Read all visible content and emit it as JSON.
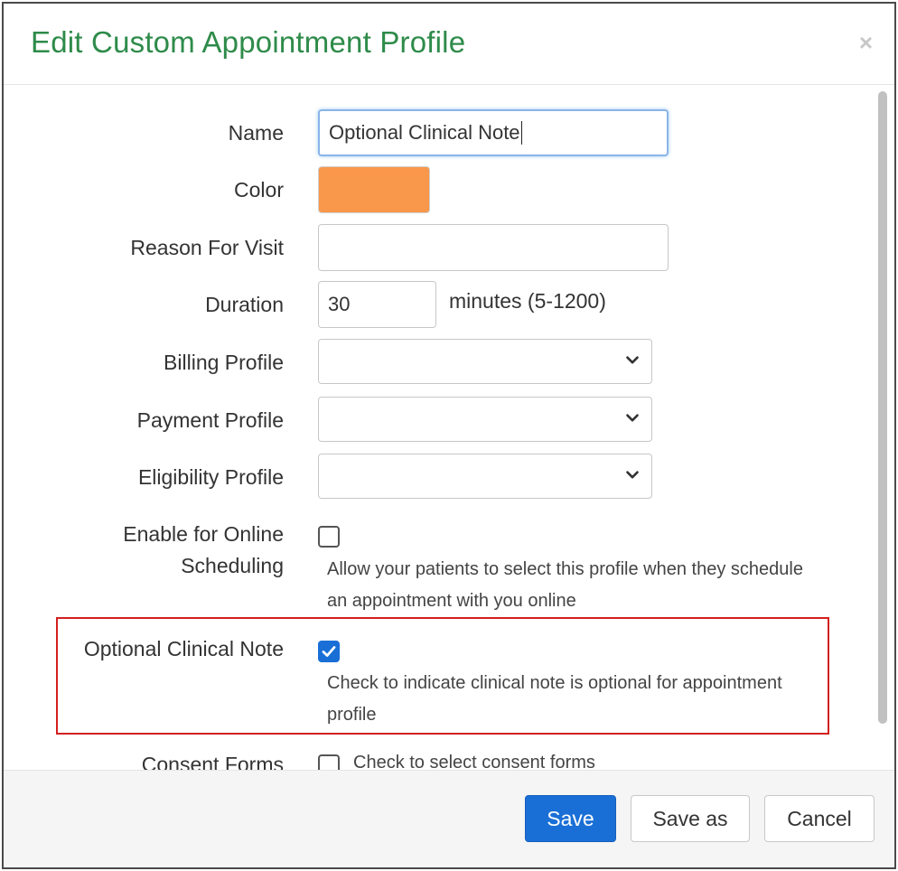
{
  "dialog": {
    "title": "Edit Custom Appointment Profile",
    "close_label": "×"
  },
  "form": {
    "name": {
      "label": "Name",
      "value": "Optional Clinical Note"
    },
    "color": {
      "label": "Color",
      "value": "#f9974a"
    },
    "reason_for_visit": {
      "label": "Reason For Visit",
      "value": ""
    },
    "duration": {
      "label": "Duration",
      "value": "30",
      "unit": "minutes (5-1200)"
    },
    "billing_profile": {
      "label": "Billing Profile",
      "selected": ""
    },
    "payment_profile": {
      "label": "Payment Profile",
      "selected": ""
    },
    "eligibility_profile": {
      "label": "Eligibility Profile",
      "selected": ""
    },
    "online_scheduling": {
      "label_line1": "Enable for Online",
      "label_line2": "Scheduling",
      "checked": false,
      "hint_line1": "Allow your patients to select this profile when they schedule",
      "hint_line2": "an appointment with you online"
    },
    "optional_clinical_note": {
      "label": "Optional Clinical Note",
      "checked": true,
      "hint_line1": "Check to indicate clinical note is optional for appointment",
      "hint_line2": "profile"
    },
    "consent_forms": {
      "label": "Consent Forms",
      "checked": false,
      "hint": "Check to select consent forms"
    }
  },
  "footer": {
    "save_label": "Save",
    "save_as_label": "Save as",
    "cancel_label": "Cancel"
  },
  "colors": {
    "title": "#2e8b4a",
    "primary": "#1a6fd6",
    "highlight": "#d3201f",
    "swatch": "#f9974a"
  }
}
